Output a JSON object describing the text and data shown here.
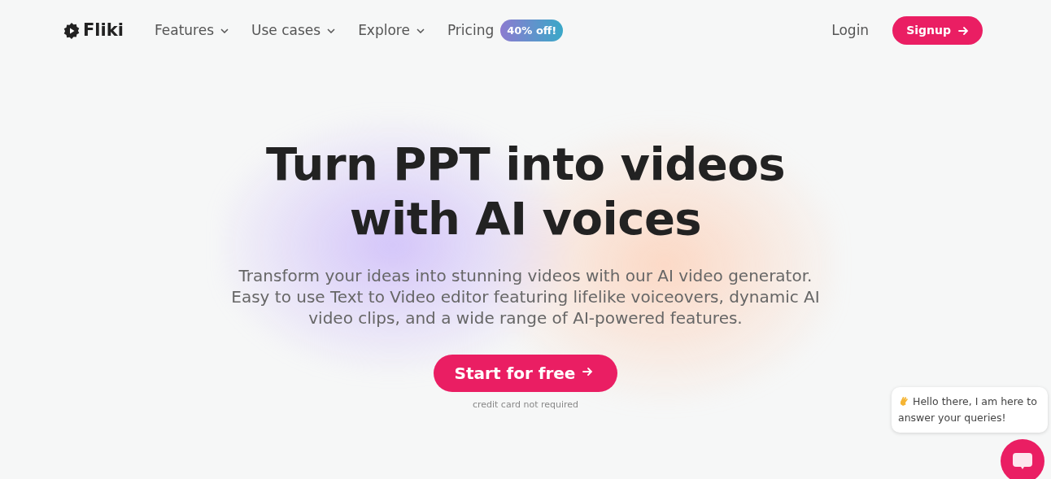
{
  "brand": "Fliki",
  "nav": [
    {
      "label": "Features",
      "dropdown": true
    },
    {
      "label": "Use cases",
      "dropdown": true
    },
    {
      "label": "Explore",
      "dropdown": true
    },
    {
      "label": "Pricing",
      "dropdown": false,
      "badge": "40% off!"
    }
  ],
  "login": "Login",
  "signup": "Signup",
  "hero": {
    "title_lines": [
      "Turn PPT into videos",
      "with AI voices"
    ],
    "subtitle": "Transform your ideas into stunning videos with our AI video generator. Easy to use Text to Video editor featuring lifelike voiceovers, dynamic AI video clips, and a wide range of AI-powered features.",
    "cta": "Start for free",
    "note": "credit card not required"
  },
  "chat": {
    "message": "Hello there, I am here to answer your queries!"
  }
}
